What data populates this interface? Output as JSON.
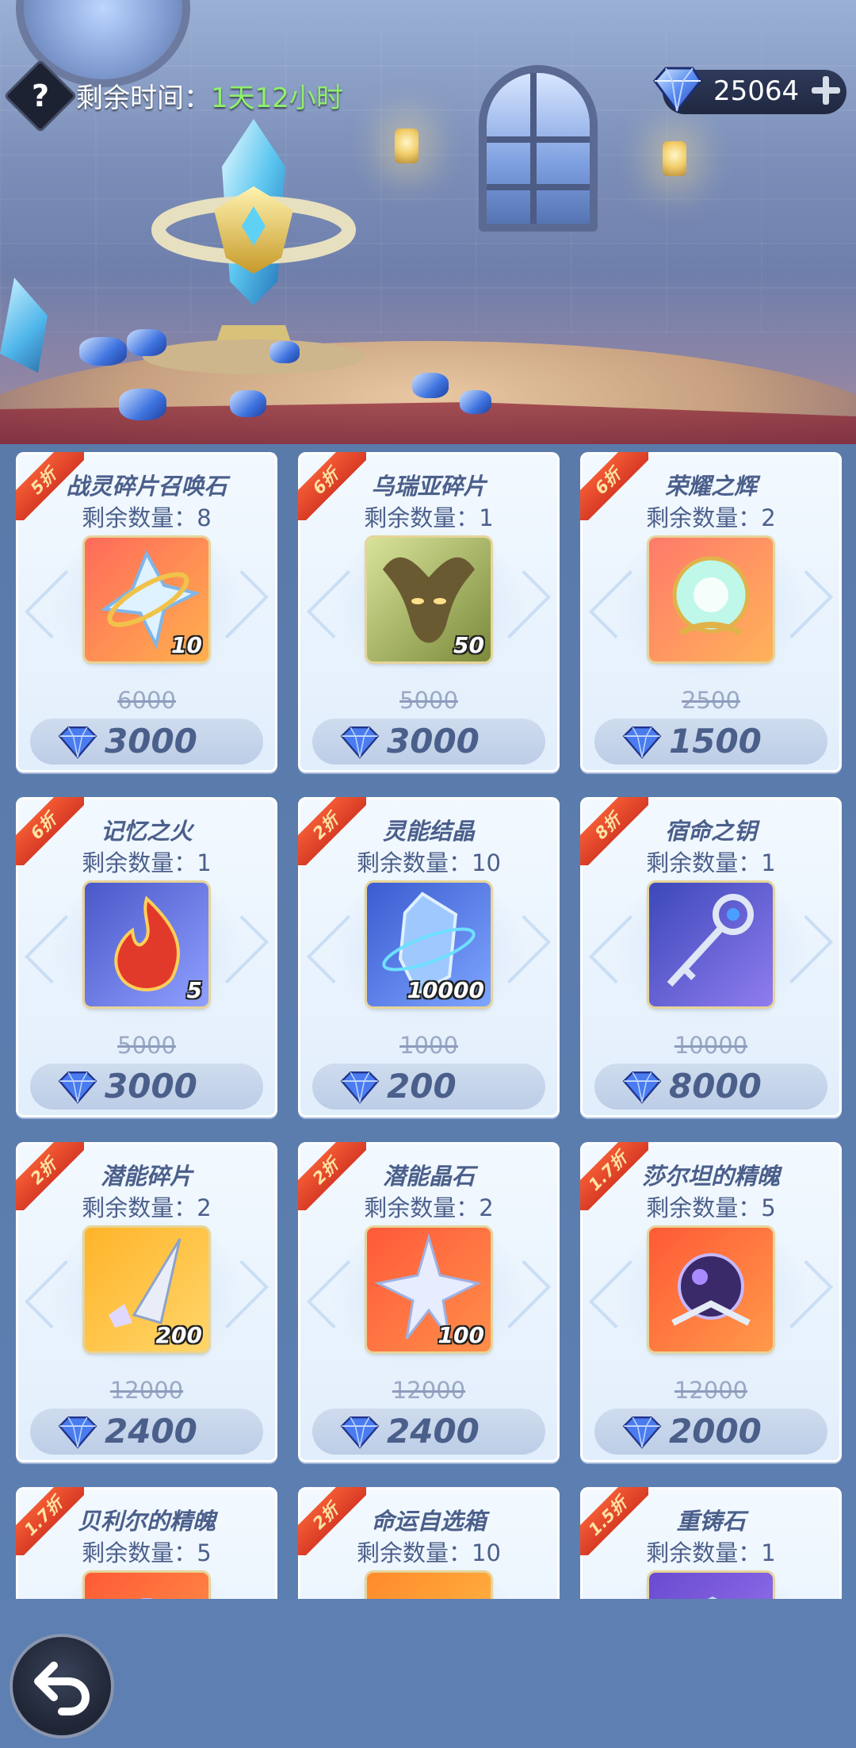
{
  "header": {
    "time_label": "剩余时间：",
    "time_value": "1天12小时",
    "currency_amount": "25064"
  },
  "icons": {
    "help": "help-icon",
    "currency": "diamond-icon",
    "add": "plus-icon",
    "back": "back-arrow-icon"
  },
  "colors": {
    "discount_ribbon": "#e4472c",
    "time_green": "#8ff06a",
    "card_text": "#4b5f8b"
  },
  "shop": {
    "items": [
      {
        "discount": "5折",
        "name": "战灵碎片召唤石",
        "stock": "剩余数量：8",
        "qty": "10",
        "original": "6000",
        "price": "3000",
        "icon": "summon-stone-icon"
      },
      {
        "discount": "6折",
        "name": "乌瑞亚碎片",
        "stock": "剩余数量：1",
        "qty": "50",
        "original": "5000",
        "price": "3000",
        "icon": "uriah-shard-icon"
      },
      {
        "discount": "6折",
        "name": "荣耀之辉",
        "stock": "剩余数量：2",
        "qty": "",
        "original": "2500",
        "price": "1500",
        "icon": "glory-orb-icon"
      },
      {
        "discount": "6折",
        "name": "记忆之火",
        "stock": "剩余数量：1",
        "qty": "5",
        "original": "5000",
        "price": "3000",
        "icon": "memory-fire-icon"
      },
      {
        "discount": "2折",
        "name": "灵能结晶",
        "stock": "剩余数量：10",
        "qty": "10000",
        "original": "1000",
        "price": "200",
        "icon": "psionic-crystal-icon"
      },
      {
        "discount": "8折",
        "name": "宿命之钥",
        "stock": "剩余数量：1",
        "qty": "",
        "original": "10000",
        "price": "8000",
        "icon": "destiny-key-icon"
      },
      {
        "discount": "2折",
        "name": "潜能碎片",
        "stock": "剩余数量：2",
        "qty": "200",
        "original": "12000",
        "price": "2400",
        "icon": "potential-shard-icon"
      },
      {
        "discount": "2折",
        "name": "潜能晶石",
        "stock": "剩余数量：2",
        "qty": "100",
        "original": "12000",
        "price": "2400",
        "icon": "potential-crystal-icon"
      },
      {
        "discount": "1.7折",
        "name": "莎尔坦的精魄",
        "stock": "剩余数量：5",
        "qty": "",
        "original": "12000",
        "price": "2000",
        "icon": "soul-orb-icon"
      },
      {
        "discount": "1.7折",
        "name": "贝利尔的精魄",
        "stock": "剩余数量：5",
        "qty": "",
        "original": "",
        "price": "",
        "icon": "soul-orb-icon"
      },
      {
        "discount": "2折",
        "name": "命运自选箱",
        "stock": "剩余数量：10",
        "qty": "",
        "original": "",
        "price": "",
        "icon": "fate-box-icon"
      },
      {
        "discount": "1.5折",
        "name": "重铸石",
        "stock": "剩余数量：1",
        "qty": "",
        "original": "",
        "price": "",
        "icon": "reforge-stone-icon"
      }
    ]
  }
}
